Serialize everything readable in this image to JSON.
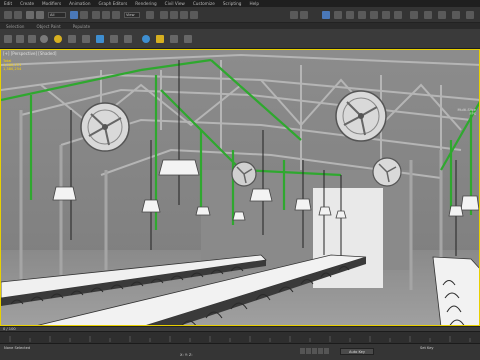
{
  "menu": {
    "items": [
      "Edit",
      "Create",
      "Modifiers",
      "Animation",
      "Graph Editors",
      "Rendering",
      "Civil View",
      "Customize",
      "Scripting",
      "Help"
    ]
  },
  "toolbar_top": {
    "selection_filter": "All",
    "view_dropdown": "View"
  },
  "ribbon": {
    "tabs": [
      "Selection",
      "Object Paint",
      "Populate"
    ]
  },
  "viewport": {
    "label": "[+] [Perspective] [Shaded]",
    "stats_lines": [
      "Total",
      "1,380,251",
      "1,380,254"
    ],
    "right_stats_lines": [
      "Multi-Slice",
      "FPS"
    ]
  },
  "timeline": {
    "frame_counter": "0 / 100"
  },
  "statusbar": {
    "text": "None Selected",
    "coords": "X:  Y:  Z:",
    "anim_label": "Auto Key",
    "right_text": "Set Key"
  },
  "colors": {
    "accent_yellow": "#e8d000",
    "viewport_grey": "#8f8f8f",
    "pipe_green": "#2fa82f"
  }
}
